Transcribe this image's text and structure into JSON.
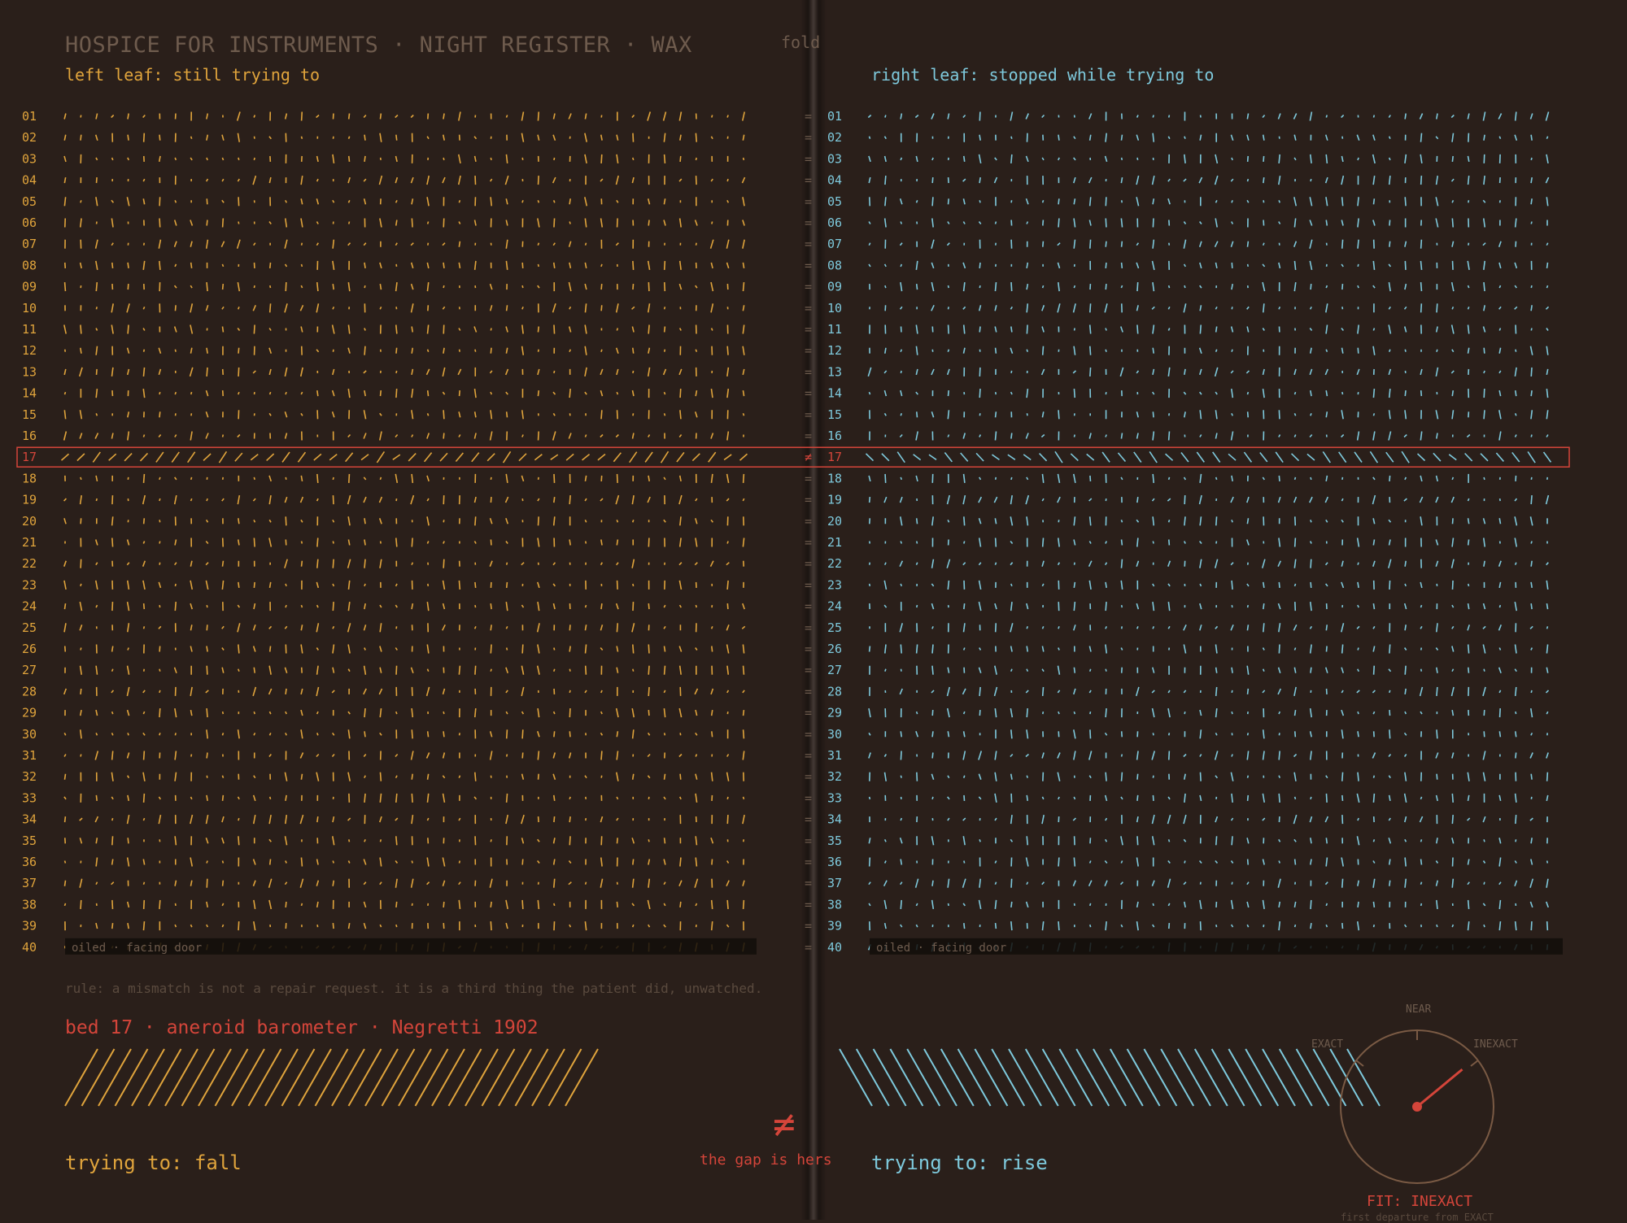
{
  "header": {
    "title": "HOSPICE FOR INSTRUMENTS · NIGHT REGISTER · WAX",
    "fold_label": "fold"
  },
  "left_leaf": {
    "label": "left leaf: still trying to",
    "footer_text": "oiled · facing door",
    "trying_to": "trying to: fall"
  },
  "right_leaf": {
    "label": "right leaf: stopped while trying to",
    "footer_text": "oiled · facing door",
    "trying_to": "trying to: rise"
  },
  "register": {
    "rows": [
      "01",
      "02",
      "03",
      "04",
      "05",
      "06",
      "07",
      "08",
      "09",
      "10",
      "11",
      "12",
      "13",
      "14",
      "15",
      "16",
      "17",
      "18",
      "19",
      "20",
      "21",
      "22",
      "23",
      "24",
      "25",
      "26",
      "27",
      "28",
      "29",
      "30",
      "31",
      "32",
      "33",
      "34",
      "35",
      "36",
      "37",
      "38",
      "39",
      "40"
    ],
    "highlighted_row": "17",
    "match_symbol": "=",
    "mismatch_symbol": "≠",
    "marks_per_row": 44
  },
  "rule": "rule: a mismatch is not a repair request. it is a third thing the patient did, unwatched.",
  "patient": "bed 17 · aneroid barometer · Negretti 1902",
  "gap": {
    "symbol": "≠",
    "label": "the gap is hers"
  },
  "gauge": {
    "labels": {
      "near": "NEAR",
      "exact": "EXACT",
      "inexact": "INEXACT"
    },
    "fit": "FIT: INEXACT",
    "first_departure": "first departure from EXACT",
    "needle_level": 0.78
  },
  "colors": {
    "background": "#2a1f1a",
    "amber": "#e0a43c",
    "cyan": "#7ec9dc",
    "red": "#d4453a",
    "muted": "#6e5b4d"
  }
}
